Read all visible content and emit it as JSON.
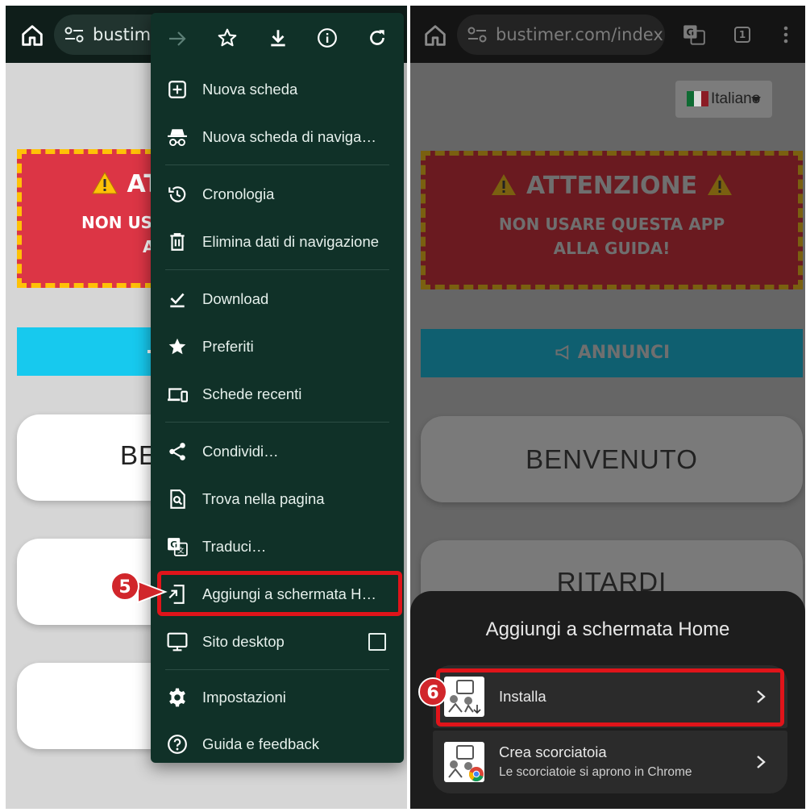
{
  "left": {
    "url": "bustimer.c",
    "warning": {
      "title": "ATT",
      "line1": "NON US",
      "line2": "A"
    },
    "cards": {
      "first": "BE"
    },
    "menu": {
      "items": [
        {
          "id": "new-tab",
          "label": "Nuova scheda",
          "icon": "plus-square-icon"
        },
        {
          "id": "incognito",
          "label": "Nuova scheda di naviga…",
          "icon": "incognito-icon"
        },
        {
          "id": "history",
          "label": "Cronologia",
          "icon": "history-icon"
        },
        {
          "id": "clear-data",
          "label": "Elimina dati di navigazione",
          "icon": "trash-icon"
        },
        {
          "id": "downloads",
          "label": "Download",
          "icon": "download-check-icon"
        },
        {
          "id": "bookmarks",
          "label": "Preferiti",
          "icon": "star-icon"
        },
        {
          "id": "recent-tabs",
          "label": "Schede recenti",
          "icon": "devices-icon"
        },
        {
          "id": "share",
          "label": "Condividi…",
          "icon": "share-icon"
        },
        {
          "id": "find",
          "label": "Trova nella pagina",
          "icon": "find-in-page-icon"
        },
        {
          "id": "translate",
          "label": "Traduci…",
          "icon": "translate-icon"
        },
        {
          "id": "add-home",
          "label": "Aggiungi a schermata H…",
          "icon": "add-to-home-icon"
        },
        {
          "id": "desktop-site",
          "label": "Sito desktop",
          "icon": "monitor-icon"
        },
        {
          "id": "settings",
          "label": "Impostazioni",
          "icon": "gear-icon"
        },
        {
          "id": "help",
          "label": "Guida e feedback",
          "icon": "help-icon"
        }
      ]
    },
    "step_badge": "5"
  },
  "right": {
    "url": "bustimer.com/index.htm",
    "tab_count": "1",
    "language": "Italiano",
    "warning": {
      "title": "ATTENZIONE",
      "line1": "NON USARE QUESTA APP",
      "line2": "ALLA GUIDA!"
    },
    "announce": "ANNUNCI",
    "cards": {
      "welcome": "BENVENUTO",
      "delays": "RITARDI"
    },
    "sheet": {
      "title": "Aggiungi a schermata Home",
      "install": "Installa",
      "shortcut_title": "Crea scorciatoia",
      "shortcut_sub": "Le scorciatoie si aprono in Chrome"
    },
    "step_badge": "6"
  },
  "colors": {
    "menu_bg": "#103128",
    "highlight": "#e0141a",
    "warning_red": "#dc3545",
    "warning_border": "#ffc107",
    "announce_cyan": "#17c9ee"
  }
}
